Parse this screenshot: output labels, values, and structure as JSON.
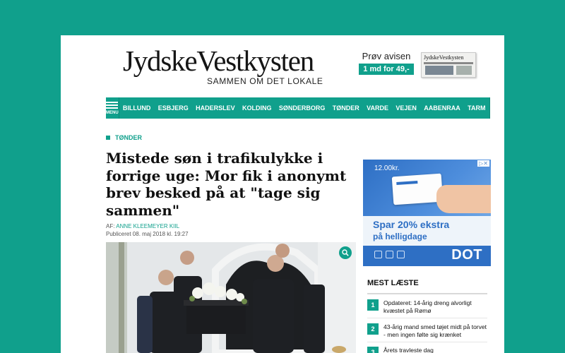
{
  "masthead": {
    "logo": "JydskeVestkysten",
    "tagline": "SAMMEN OM DET LOKALE"
  },
  "promo": {
    "title": "Prøv avisen",
    "offer": "1 md for 49,-",
    "paper_name": "JydskeVestkysten"
  },
  "nav": {
    "menu_label": "MENU",
    "items": [
      "BILLUND",
      "ESBJERG",
      "HADERSLEV",
      "KOLDING",
      "SØNDERBORG",
      "TØNDER",
      "VARDE",
      "VEJEN",
      "AABENRAA",
      "TARM"
    ]
  },
  "article": {
    "section": "TØNDER",
    "headline": "Mistede søn i trafikulykke i forrige uge: Mor fik i anonymt brev besked på at \"tage sig sammen\"",
    "byline_prefix": "AF: ",
    "author": "ANNE KLEEMEYER KIIL",
    "published": "Publiceret 08. maj 2018 kl. 19:27"
  },
  "ad": {
    "price": "12.00kr.",
    "adchoice": "▷✕",
    "headline": "Spar 20% ekstra",
    "subline": "på helligdage",
    "brand": "DOT"
  },
  "most_read": {
    "title": "MEST LÆSTE",
    "items": [
      {
        "number": "1",
        "text": "Opdateret: 14-årig dreng alvorligt kvæstet på Rømø"
      },
      {
        "number": "2",
        "text": "43-årig mand smed tøjet midt på torvet - men ingen følte sig krænket"
      },
      {
        "number": "3",
        "text": "Årets travleste dag"
      }
    ]
  },
  "colors": {
    "accent": "#10a08c",
    "ad_blue": "#2e6fc4"
  }
}
